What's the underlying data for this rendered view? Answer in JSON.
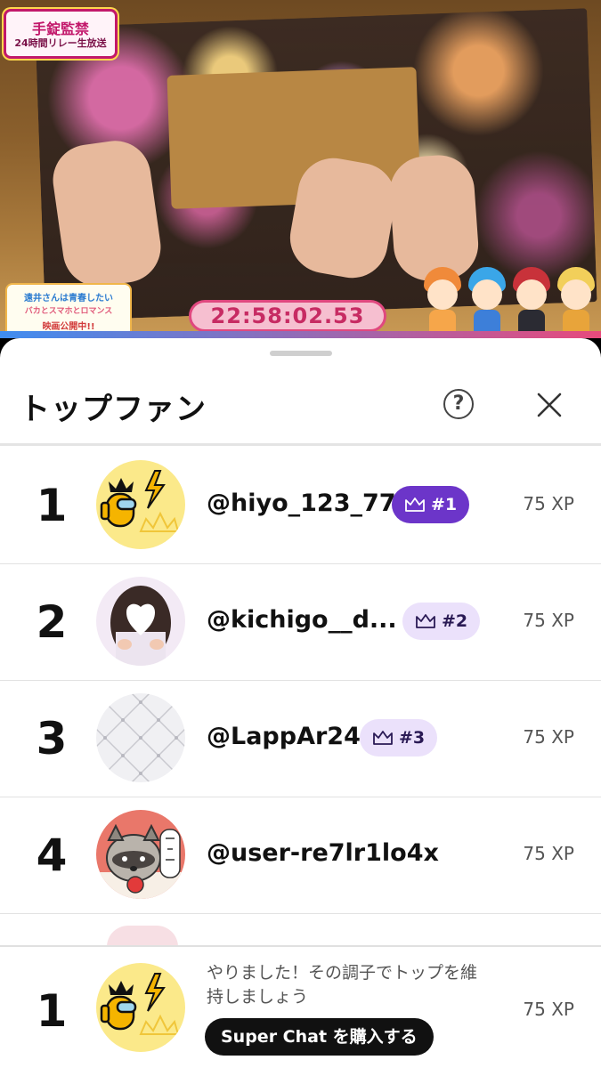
{
  "video": {
    "logo_main": "手錠監禁",
    "logo_sub": "24時間リレー生放送",
    "promo_title": "遠井さんは青春したい",
    "promo_subtitle": "バカとスマホとロマンス",
    "promo_release": "映画公開中!!",
    "timer": "22:58:02.53"
  },
  "sheet": {
    "title": "トップファン",
    "help_glyph": "?"
  },
  "fans": [
    {
      "rank": "1",
      "username": "@hiyo_123_77",
      "badge": "#1",
      "xp": "75 XP"
    },
    {
      "rank": "2",
      "username": "@kichigo__d...",
      "badge": "#2",
      "xp": "75 XP"
    },
    {
      "rank": "3",
      "username": "@LappAr24",
      "badge": "#3",
      "xp": "75 XP"
    },
    {
      "rank": "4",
      "username": "@user-re7lr1lo4x",
      "badge": "",
      "xp": "75 XP"
    }
  ],
  "me": {
    "rank": "1",
    "message": "やりました！その調子でトップを維持しましょう",
    "button": "Super Chat を購入する",
    "xp": "75 XP"
  },
  "colors": {
    "badge_top": "#6c35c9",
    "badge_light": "#ebe1fb",
    "timer_pink": "#e0487f"
  },
  "icons": [
    "help-icon",
    "close-icon",
    "crown-icon"
  ]
}
